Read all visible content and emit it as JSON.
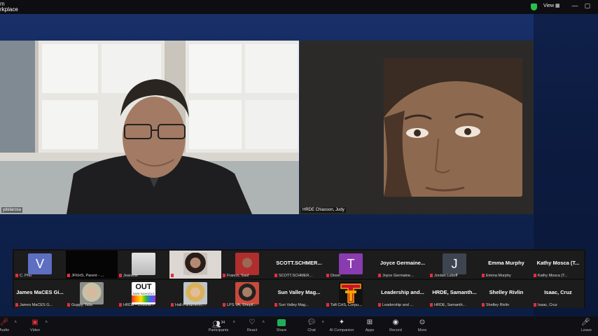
{
  "window": {
    "title_line1": "m",
    "title_line2": "rkplace",
    "view_label": "View",
    "controls": [
      "—",
      "▢",
      "✕"
    ]
  },
  "videos": {
    "main_left_name": "ydelarosa",
    "main_right_name": "HRDE Chiasson, Judy"
  },
  "participants": [
    {
      "name": "C. Phu",
      "avatar_letter": "V",
      "avatar_color": "#5d6fc0"
    },
    {
      "name": "JFKHS, Parent - ...",
      "kind": "dark"
    },
    {
      "name": "Jeanette",
      "kind": "photo"
    },
    {
      "name": "LPSUL - Izquierdo, ...",
      "kind": "photo"
    },
    {
      "name": "Franco, Saul",
      "kind": "photo"
    },
    {
      "name": "SCOTT.SCHMER...",
      "label": "SCOTT.SCHMER..."
    },
    {
      "name": "Dixon",
      "avatar_letter": "T",
      "avatar_color": "#8a3bb0"
    },
    {
      "name": "Joyce Germaine...",
      "label": "Joyce Germaine..."
    },
    {
      "name": "Jordan Luboff",
      "avatar_letter": "J",
      "avatar_color": "#3d4650"
    },
    {
      "name": "Emma Murphy",
      "label": "Emma Murphy"
    },
    {
      "name": "Kathy Mosca (T...",
      "label": "Kathy Mosca (T..."
    },
    {
      "name": "James MaCES G...",
      "label": "James MaCES Gi..."
    },
    {
      "name": "Guppy, Talia",
      "kind": "photo"
    },
    {
      "name": "HRDE - Cristina...",
      "kind": "out"
    },
    {
      "name": "Hall-Panameno,...",
      "kind": "photo"
    },
    {
      "name": "LPS VA, Shepif...",
      "kind": "photo"
    },
    {
      "name": "Sun Valley Mag...",
      "label": "Sun Valley Mag..."
    },
    {
      "name": "Taft CHS, Corpu...",
      "kind": "logo"
    },
    {
      "name": "Leadership and ...",
      "label": "Leadership and..."
    },
    {
      "name": "HRDE, Samanth...",
      "label": "HRDE, Samanth..."
    },
    {
      "name": "Shelley Rivlin",
      "label": "Shelley Rivlin"
    },
    {
      "name": "Isaac, Cruz",
      "label": "Isaac, Cruz"
    }
  ],
  "out_logo": {
    "big": "OUT",
    "small": "SAFE SCHOOLS"
  },
  "toolbar": {
    "audio": "Audio",
    "video": "Video",
    "participants": "Participants",
    "participants_count": "34",
    "react": "React",
    "share": "Share",
    "chat": "Chat",
    "ai_companion": "AI Companion",
    "apps": "Apps",
    "record": "Record",
    "more": "More",
    "leave": "Leave"
  },
  "colors": {
    "stage": "#102451",
    "share_green": "#1fae5a",
    "unmuted_red": "#e0303a"
  }
}
